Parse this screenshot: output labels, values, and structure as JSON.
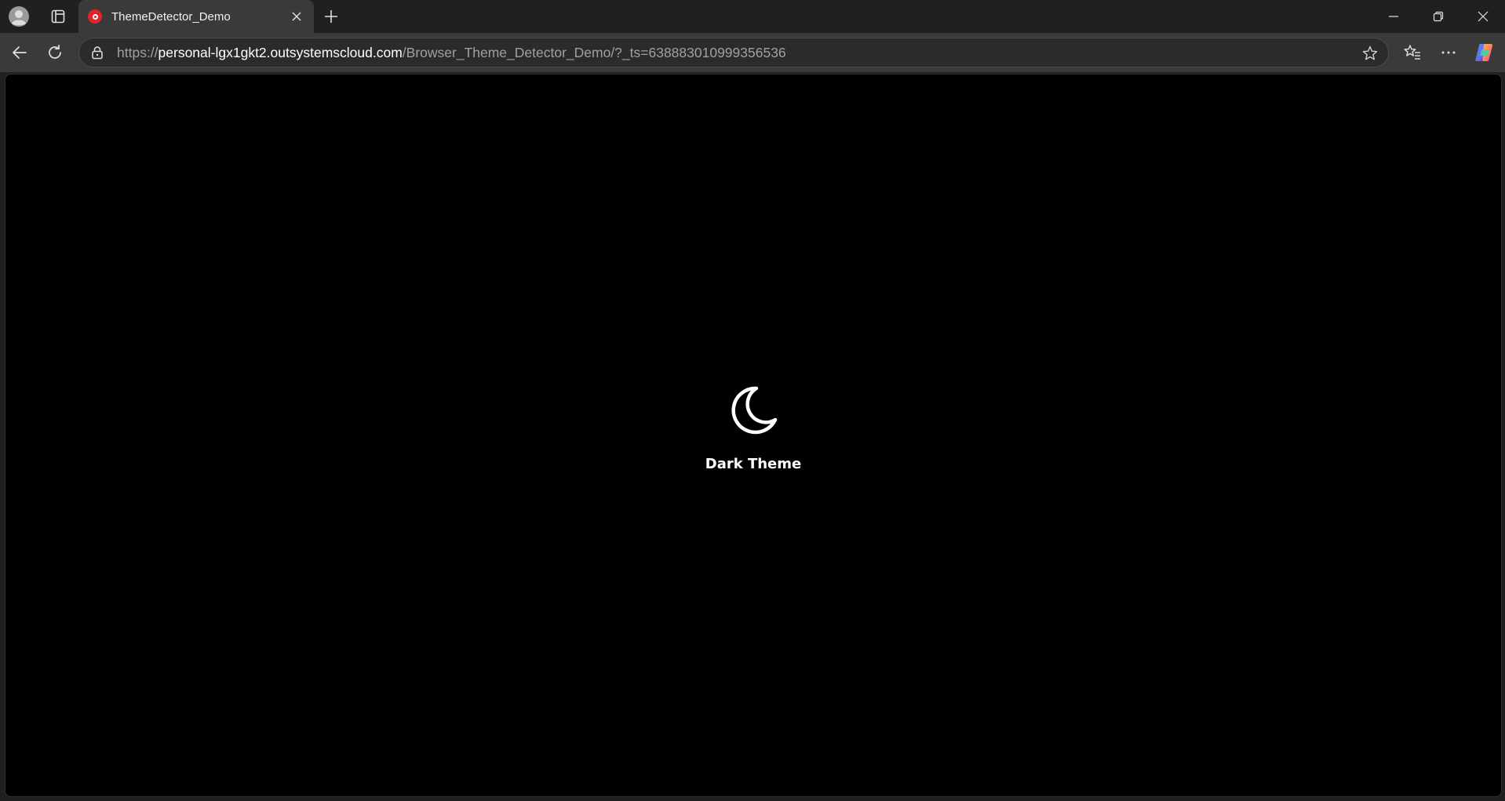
{
  "tab": {
    "title": "ThemeDetector_Demo",
    "favicon_color": "#e3222a"
  },
  "address_bar": {
    "url_scheme": "https://",
    "url_host": "personal-lgx1gkt2.outsystemscloud.com",
    "url_path": "/Browser_Theme_Detector_Demo/?_ts=638883010999356536"
  },
  "icons": {
    "profile": "profile-avatar-icon",
    "workspaces": "tab-actions-icon",
    "close_tab": "close-icon",
    "new_tab": "plus-icon",
    "minimize": "minimize-icon",
    "restore": "restore-icon",
    "close_window": "close-icon",
    "back": "arrow-left-icon",
    "reload": "refresh-icon",
    "site_info": "lock-icon",
    "favorite": "star-icon",
    "favorites": "favorites-list-icon",
    "more": "ellipsis-icon",
    "copilot": "copilot-icon",
    "theme": "moon-icon"
  },
  "page": {
    "theme_label": "Dark Theme",
    "background": "#000000"
  }
}
